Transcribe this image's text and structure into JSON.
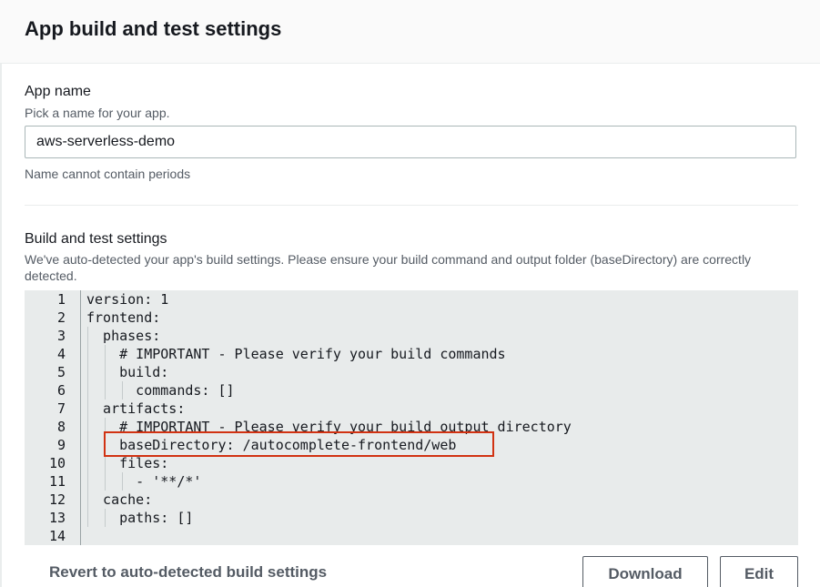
{
  "header": {
    "title": "App build and test settings"
  },
  "app_name": {
    "label": "App name",
    "description": "Pick a name for your app.",
    "value": "aws-serverless-demo",
    "constraint": "Name cannot contain periods"
  },
  "build_settings": {
    "label": "Build and test settings",
    "description": "We've auto-detected your app's build settings. Please ensure your build command and output folder (baseDirectory) are correctly detected.",
    "editor": {
      "lines": [
        {
          "num": "1",
          "text": "version: 1"
        },
        {
          "num": "2",
          "text": "frontend:"
        },
        {
          "num": "3",
          "text": "  phases:"
        },
        {
          "num": "4",
          "text": "    # IMPORTANT - Please verify your build commands"
        },
        {
          "num": "5",
          "text": "    build:"
        },
        {
          "num": "6",
          "text": "      commands: []"
        },
        {
          "num": "7",
          "text": "  artifacts:"
        },
        {
          "num": "8",
          "text": "    # IMPORTANT - Please verify your build output directory"
        },
        {
          "num": "9",
          "text": "    baseDirectory: /autocomplete-frontend/web"
        },
        {
          "num": "10",
          "text": "    files:"
        },
        {
          "num": "11",
          "text": "      - '**/*'"
        },
        {
          "num": "12",
          "text": "  cache:"
        },
        {
          "num": "13",
          "text": "    paths: []"
        },
        {
          "num": "14",
          "text": ""
        }
      ]
    }
  },
  "actions": {
    "revert_label": "Revert to auto-detected build settings",
    "download_label": "Download",
    "edit_label": "Edit"
  },
  "colors": {
    "highlight": "#d13212",
    "editor_bg": "#e8ebeb"
  }
}
